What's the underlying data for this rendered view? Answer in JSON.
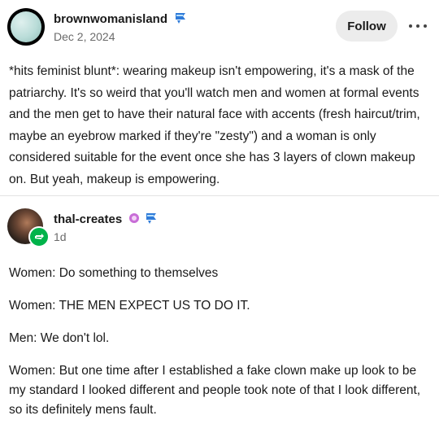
{
  "post": {
    "username": "brownwomanisland",
    "date": "Dec 2, 2024",
    "follow_label": "Follow",
    "text": "*hits feminist blunt*: wearing makeup isn't empowering, it's a mask of the patriarchy. It's so weird that you'll watch men and women at formal events and the men get to have their natural face with accents (fresh haircut/trim, maybe an eyebrow marked if they're \"zesty\") and a woman is only considered suitable for the event once she has 3 layers of clown makeup on. But yeah, makeup is empowering."
  },
  "reblog": {
    "username": "thal-creates",
    "time": "1d",
    "paragraphs": [
      "Women: Do something to themselves",
      "Women: THE MEN EXPECT US TO DO IT.",
      "Men: We don't lol.",
      "Women: But one time after I established a fake clown make up look to be my standard I looked different and people took note of that I look different, so its definitely mens fault."
    ]
  },
  "colors": {
    "badge_blue": "#2f7bd9",
    "reblog_green": "#00b34a",
    "badge_pink": "#c86dd7"
  },
  "icons": [
    "blue-checkmark-badge-icon",
    "pink-badge-icon",
    "reblog-icon",
    "more-options-icon"
  ]
}
